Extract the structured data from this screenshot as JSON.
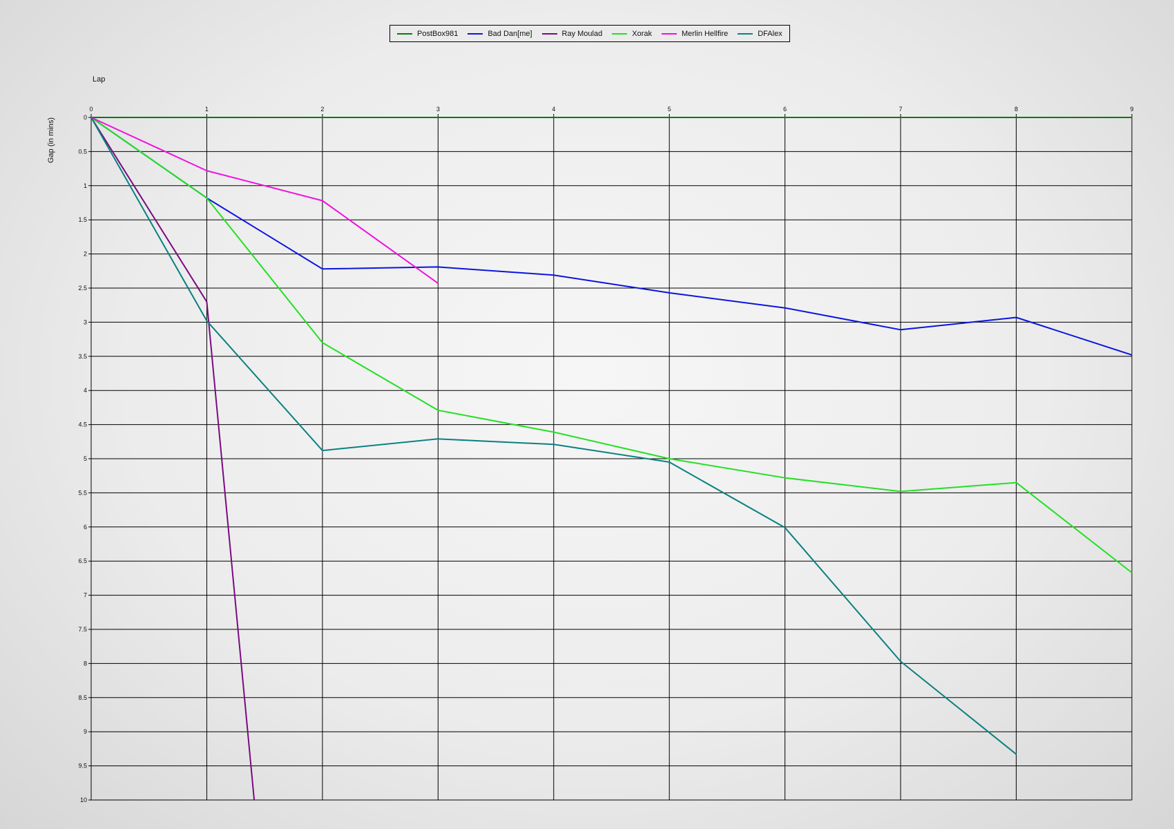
{
  "chart_data": {
    "type": "line",
    "xlabel": "Lap",
    "ylabel": "Gap (in mins)",
    "x": [
      0,
      1,
      2,
      3,
      4,
      5,
      6,
      7,
      8,
      9
    ],
    "xlim": [
      0,
      9
    ],
    "ylim": [
      0,
      10
    ],
    "y_inverted": true,
    "x_axis_position": "top",
    "yticks": [
      "0",
      "0.5",
      "1",
      "1.5",
      "2",
      "2.5",
      "3",
      "3.5",
      "4",
      "4.5",
      "5",
      "5.5",
      "6",
      "6.5",
      "7",
      "7.5",
      "8",
      "8.5",
      "9",
      "9.5",
      "10"
    ],
    "xticks": [
      "0",
      "1",
      "2",
      "3",
      "4",
      "5",
      "6",
      "7",
      "8",
      "9"
    ],
    "grid": true,
    "legend_position": "top-center",
    "series": [
      {
        "name": "PostBox981",
        "color": "#0a7a0a",
        "points": [
          [
            0,
            0
          ],
          [
            1,
            0
          ],
          [
            2,
            0
          ],
          [
            3,
            0
          ],
          [
            4,
            0
          ],
          [
            5,
            0
          ],
          [
            6,
            0
          ],
          [
            7,
            0
          ],
          [
            8,
            0
          ],
          [
            9,
            0
          ]
        ]
      },
      {
        "name": "Bad Dan[me]",
        "color": "#0a14e0",
        "points": [
          [
            0,
            0
          ],
          [
            1,
            1.18
          ],
          [
            2,
            2.22
          ],
          [
            3,
            2.19
          ],
          [
            4,
            2.31
          ],
          [
            5,
            2.57
          ],
          [
            6,
            2.79
          ],
          [
            7,
            3.11
          ],
          [
            8,
            2.93
          ],
          [
            9,
            3.48
          ]
        ]
      },
      {
        "name": "Ray Moulad",
        "color": "#7a0a80",
        "points": [
          [
            0,
            0
          ],
          [
            1,
            2.7
          ],
          [
            1.41,
            10
          ]
        ]
      },
      {
        "name": "Xorak",
        "color": "#22e022",
        "points": [
          [
            0,
            0
          ],
          [
            1,
            1.18
          ],
          [
            2,
            3.3
          ],
          [
            3,
            4.29
          ],
          [
            4,
            4.61
          ],
          [
            5,
            5.0
          ],
          [
            6,
            5.28
          ],
          [
            7,
            5.48
          ],
          [
            8,
            5.35
          ],
          [
            9,
            6.67
          ]
        ]
      },
      {
        "name": "Merlin Hellfire",
        "color": "#f010e0",
        "points": [
          [
            0,
            0
          ],
          [
            1,
            0.78
          ],
          [
            2,
            1.22
          ],
          [
            3,
            2.43
          ]
        ]
      },
      {
        "name": "DFAlex",
        "color": "#0a8080",
        "points": [
          [
            0,
            0
          ],
          [
            1,
            2.98
          ],
          [
            2,
            4.88
          ],
          [
            3,
            4.71
          ],
          [
            4,
            4.79
          ],
          [
            5,
            5.05
          ],
          [
            6,
            6.01
          ],
          [
            7,
            7.97
          ],
          [
            8,
            9.33
          ]
        ]
      }
    ]
  }
}
